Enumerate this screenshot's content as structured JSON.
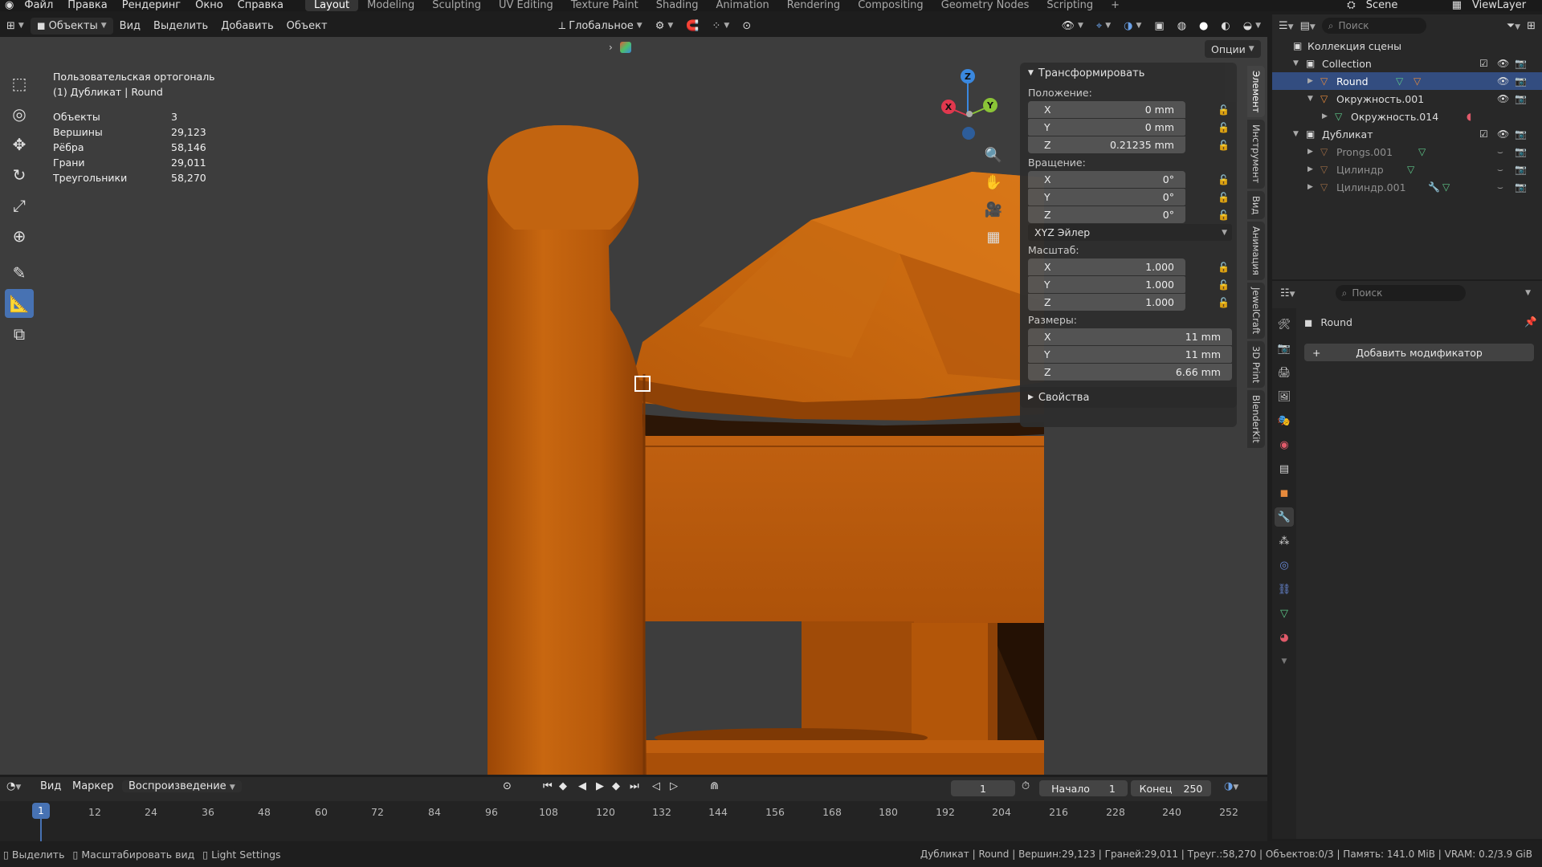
{
  "menu": {
    "items": [
      "Файл",
      "Правка",
      "Рендеринг",
      "Окно",
      "Справка"
    ],
    "workspaces": [
      "Layout",
      "Modeling",
      "Sculpting",
      "UV Editing",
      "Texture Paint",
      "Shading",
      "Animation",
      "Rendering",
      "Compositing",
      "Geometry Nodes",
      "Scripting"
    ],
    "active_workspace": "Layout",
    "add_tab": "+",
    "scene": "Scene",
    "view_layer": "ViewLayer"
  },
  "viewport_header": {
    "mode": "Объекты",
    "menus": [
      "Вид",
      "Выделить",
      "Добавить",
      "Объект"
    ],
    "orientation": "Глобальное",
    "options": "Опции"
  },
  "overlay": {
    "view_name": "Пользовательская ортогональ",
    "object_info": "(1) Дубликат | Round",
    "stats": [
      {
        "label": "Объекты",
        "value": "3"
      },
      {
        "label": "Вершины",
        "value": "29,123"
      },
      {
        "label": "Рёбра",
        "value": "58,146"
      },
      {
        "label": "Грани",
        "value": "29,011"
      },
      {
        "label": "Треугольники",
        "value": "58,270"
      }
    ]
  },
  "gizmo": {
    "x": "X",
    "y": "Y",
    "z": "Z",
    "x_color": "#e0384e",
    "y_color": "#8bc437",
    "z_color": "#3a88df"
  },
  "npanel": {
    "title": "Трансформировать",
    "location_label": "Положение:",
    "location": [
      {
        "axis": "X",
        "value": "0 mm"
      },
      {
        "axis": "Y",
        "value": "0 mm"
      },
      {
        "axis": "Z",
        "value": "0.21235 mm"
      }
    ],
    "rotation_label": "Вращение:",
    "rotation": [
      {
        "axis": "X",
        "value": "0°"
      },
      {
        "axis": "Y",
        "value": "0°"
      },
      {
        "axis": "Z",
        "value": "0°"
      }
    ],
    "rotation_mode": "XYZ Эйлер",
    "scale_label": "Масштаб:",
    "scale": [
      {
        "axis": "X",
        "value": "1.000"
      },
      {
        "axis": "Y",
        "value": "1.000"
      },
      {
        "axis": "Z",
        "value": "1.000"
      }
    ],
    "dimensions_label": "Размеры:",
    "dimensions": [
      {
        "axis": "X",
        "value": "11 mm"
      },
      {
        "axis": "Y",
        "value": "11 mm"
      },
      {
        "axis": "Z",
        "value": "6.66 mm"
      }
    ],
    "properties": "Свойства",
    "tabs": [
      "Элемент",
      "Инструмент",
      "Вид",
      "Анимация",
      "JewelCraft",
      "3D Print",
      "BlenderKit"
    ]
  },
  "outliner": {
    "search_placeholder": "Поиск",
    "rows": [
      {
        "name": "Коллекция сцены",
        "indent": 0
      },
      {
        "name": "Collection",
        "indent": 1
      },
      {
        "name": "Round",
        "indent": 2
      },
      {
        "name": "Окружность.001",
        "indent": 2
      },
      {
        "name": "Окружность.014",
        "indent": 3
      },
      {
        "name": "Дубликат",
        "indent": 1
      },
      {
        "name": "Prongs.001",
        "indent": 2
      },
      {
        "name": "Цилиндр",
        "indent": 2
      },
      {
        "name": "Цилиндр.001",
        "indent": 2
      }
    ]
  },
  "properties": {
    "search_placeholder": "Поиск",
    "object_name": "Round",
    "add_modifier": "Добавить модификатор"
  },
  "timeline": {
    "menus": [
      "Вид",
      "Маркер"
    ],
    "playback": "Воспроизведение",
    "current_frame": "1",
    "start_label": "Начало",
    "start": "1",
    "end_label": "Конец",
    "end": "250",
    "ticks": [
      "12",
      "24",
      "36",
      "48",
      "60",
      "72",
      "84",
      "96",
      "108",
      "120",
      "132",
      "144",
      "156",
      "168",
      "180",
      "192",
      "204",
      "216",
      "228",
      "240",
      "252"
    ]
  },
  "status": {
    "select": "Выделить",
    "zoom": "Масштабировать вид",
    "light": "Light Settings",
    "info": "Дубликат | Round | Вершин:29,123 | Граней:29,011 | Треуг.:58,270 | Объектов:0/3 | Память: 141.0 MiB | VRAM: 0.2/3.9 GiB"
  },
  "colors": {
    "accent": "#4772b3",
    "model": "#c4600f",
    "selection": "#334d80"
  }
}
